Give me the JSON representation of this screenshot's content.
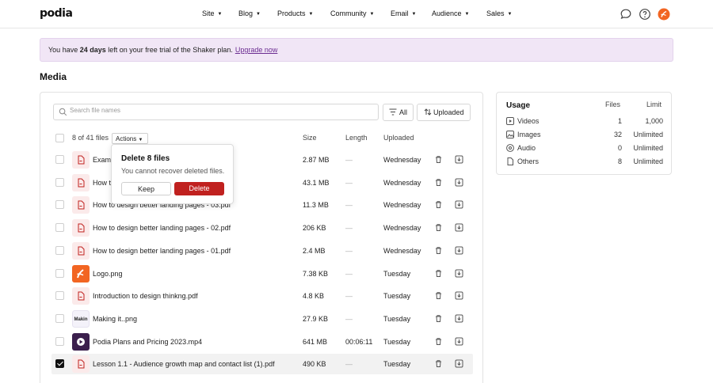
{
  "nav": {
    "logo": "podia",
    "items": [
      "Site",
      "Blog",
      "Products",
      "Community",
      "Email",
      "Audience",
      "Sales"
    ]
  },
  "banner": {
    "prefix": "You have ",
    "days": "24 days",
    "suffix": " left on your free trial of the Shaker plan.",
    "link": "Upgrade now"
  },
  "page_title": "Media",
  "toolbar": {
    "search_placeholder": "Search file names",
    "filter_label": "All",
    "sort_label": "Uploaded"
  },
  "table": {
    "selection_count": "8 of 41 files",
    "actions_label": "Actions",
    "columns": {
      "size": "Size",
      "length": "Length",
      "uploaded": "Uploaded"
    },
    "rows": [
      {
        "name": "Examp",
        "size": "2.87 MB",
        "length": "—",
        "uploaded": "Wednesday",
        "type": "pdf",
        "checked": false
      },
      {
        "name": "How to",
        "size": "43.1 MB",
        "length": "—",
        "uploaded": "Wednesday",
        "type": "pdf",
        "checked": false
      },
      {
        "name": "How to design better landing pages - 03.pdf",
        "size": "11.3 MB",
        "length": "—",
        "uploaded": "Wednesday",
        "type": "pdf",
        "checked": false
      },
      {
        "name": "How to design better landing pages - 02.pdf",
        "size": "206 KB",
        "length": "—",
        "uploaded": "Wednesday",
        "type": "pdf",
        "checked": false
      },
      {
        "name": "How to design better landing pages - 01.pdf",
        "size": "2.4 MB",
        "length": "—",
        "uploaded": "Wednesday",
        "type": "pdf",
        "checked": false
      },
      {
        "name": "Logo.png",
        "size": "7.38 KB",
        "length": "—",
        "uploaded": "Tuesday",
        "type": "logo",
        "checked": false
      },
      {
        "name": "Introduction to design thinkng.pdf",
        "size": "4.8 KB",
        "length": "—",
        "uploaded": "Tuesday",
        "type": "pdf",
        "checked": false
      },
      {
        "name": "Making it..png",
        "size": "27.9 KB",
        "length": "—",
        "uploaded": "Tuesday",
        "type": "making",
        "checked": false
      },
      {
        "name": "Podia Plans and Pricing 2023.mp4",
        "size": "641 MB",
        "length": "00:06:11",
        "uploaded": "Tuesday",
        "type": "video",
        "checked": false
      },
      {
        "name": "Lesson 1.1 - Audience growth map and contact list (1).pdf",
        "size": "490 KB",
        "length": "—",
        "uploaded": "Tuesday",
        "type": "pdf",
        "checked": true
      }
    ]
  },
  "popover": {
    "title": "Delete 8 files",
    "message": "You cannot recover deleted files.",
    "keep_label": "Keep",
    "delete_label": "Delete"
  },
  "usage": {
    "title": "Usage",
    "col_files": "Files",
    "col_limit": "Limit",
    "rows": [
      {
        "label": "Videos",
        "files": "1",
        "limit": "1,000",
        "icon": "video-icon"
      },
      {
        "label": "Images",
        "files": "32",
        "limit": "Unlimited",
        "icon": "image-icon"
      },
      {
        "label": "Audio",
        "files": "0",
        "limit": "Unlimited",
        "icon": "audio-icon"
      },
      {
        "label": "Others",
        "files": "8",
        "limit": "Unlimited",
        "icon": "file-icon"
      }
    ]
  },
  "colors": {
    "accent": "#6b2c91",
    "banner_bg": "#f1e6f6",
    "danger": "#c0211f",
    "avatar": "#f26522"
  }
}
